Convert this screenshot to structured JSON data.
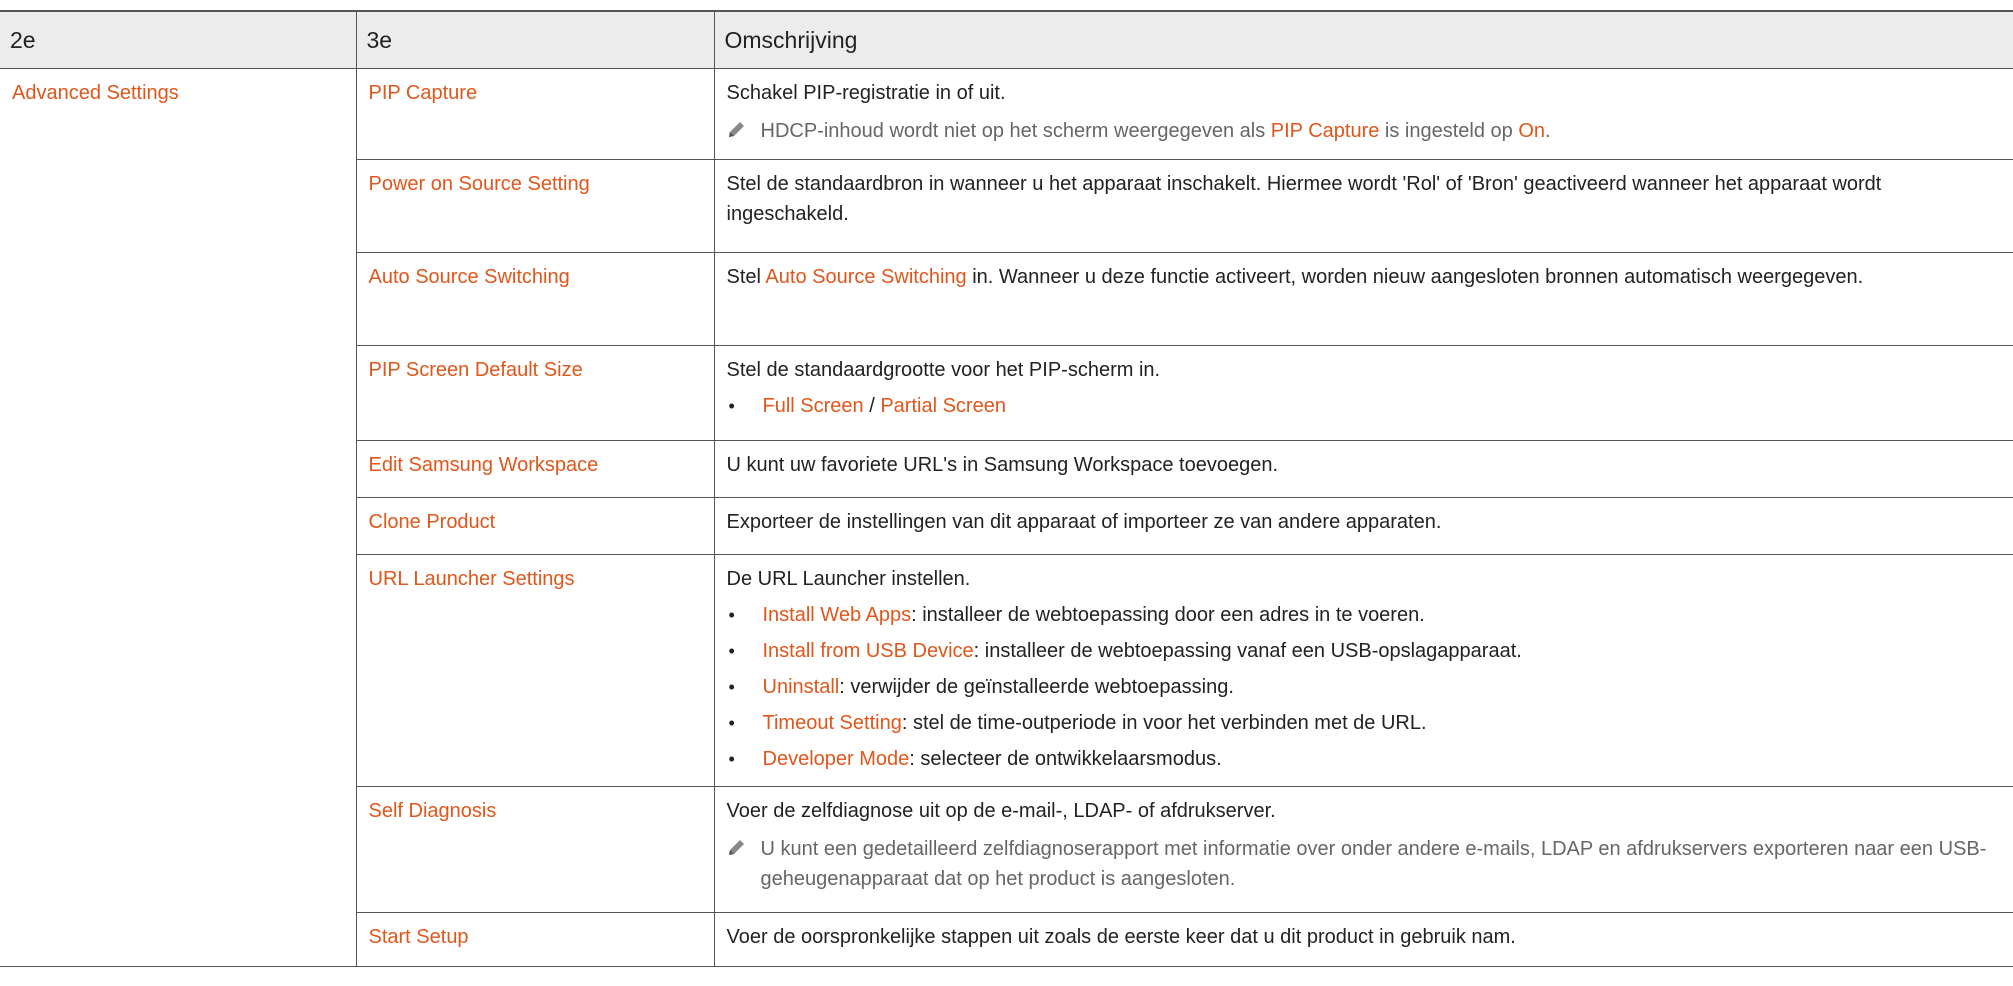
{
  "header": {
    "col1": "2e",
    "col2": "3e",
    "col3": "Omschrijving"
  },
  "section": "Advanced Settings",
  "rows": [
    {
      "name": "PIP Capture",
      "desc": "Schakel PIP-registratie in of uit.",
      "note": {
        "pre": "HDCP-inhoud wordt niet op het scherm weergegeven als ",
        "hl1": "PIP Capture",
        "mid": " is ingesteld op ",
        "hl2": "On",
        "post": "."
      }
    },
    {
      "name": "Power on Source Setting",
      "desc": "Stel de standaardbron in wanneer u het apparaat inschakelt. Hiermee wordt 'Rol' of 'Bron' geactiveerd wanneer het apparaat wordt ingeschakeld."
    },
    {
      "name": "Auto Source Switching",
      "desc_pre": "Stel ",
      "desc_hl": "Auto Source Switching",
      "desc_post": " in. Wanneer u deze functie activeert, worden nieuw aangesloten bronnen automatisch weergegeven."
    },
    {
      "name": "PIP Screen Default Size",
      "desc": "Stel de standaardgrootte voor het PIP-scherm in.",
      "option1": "Full Screen",
      "sep": " / ",
      "option2": "Partial Screen"
    },
    {
      "name": "Edit Samsung Workspace",
      "desc": "U kunt uw favoriete URL's in Samsung Workspace toevoegen."
    },
    {
      "name": "Clone Product",
      "desc": "Exporteer de instellingen van dit apparaat of importeer ze van andere apparaten."
    },
    {
      "name": "URL Launcher Settings",
      "desc": "De URL Launcher instellen.",
      "items": [
        {
          "label": "Install Web Apps",
          "text": ": installeer de webtoepassing door een adres in te voeren."
        },
        {
          "label": "Install from USB Device",
          "text": ": installeer de webtoepassing vanaf een USB-opslagapparaat."
        },
        {
          "label": "Uninstall",
          "text": ": verwijder de geïnstalleerde webtoepassing."
        },
        {
          "label": "Timeout Setting",
          "text": ": stel de time-outperiode in voor het verbinden met de URL."
        },
        {
          "label": "Developer Mode",
          "text": ": selecteer de ontwikkelaarsmodus."
        }
      ]
    },
    {
      "name": "Self Diagnosis",
      "desc": "Voer de zelfdiagnose uit op de e-mail-, LDAP- of afdrukserver.",
      "note": "U kunt een gedetailleerd zelfdiagnoserapport met informatie over onder andere e-mails, LDAP en afdrukservers exporteren naar een USB-geheugenapparaat dat op het product is aangesloten."
    },
    {
      "name": "Start Setup",
      "desc": "Voer de oorspronkelijke stappen uit zoals de eerste keer dat u dit product in gebruik nam."
    }
  ],
  "bullet_glyph": "•",
  "icons": {
    "note": "pencil-icon"
  },
  "colors": {
    "highlight": "#e0561b",
    "header_bg": "#ececec",
    "note_text": "#666666"
  }
}
